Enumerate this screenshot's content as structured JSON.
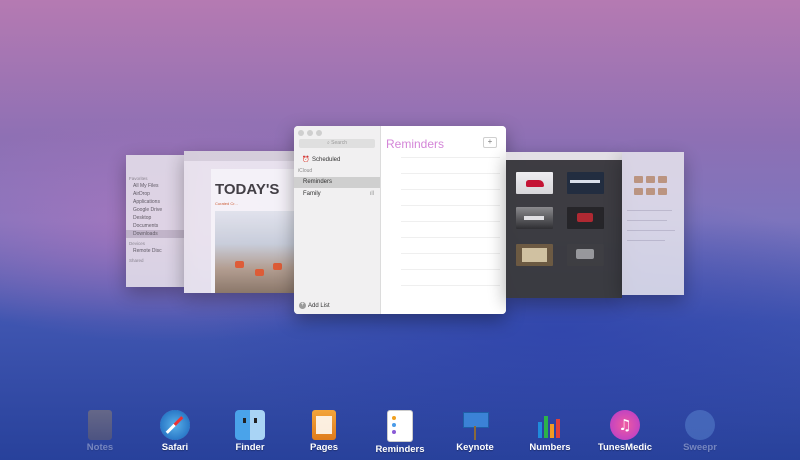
{
  "finder": {
    "favorites_header": "Favorites",
    "items": [
      "All My Files",
      "AirDrop",
      "Applications",
      "Google Drive",
      "Desktop",
      "Documents",
      "Downloads"
    ],
    "devices_header": "Devices",
    "devices": [
      "Remote Disc"
    ],
    "shared_header": "Shared"
  },
  "safari": {
    "headline": "TODAY'S",
    "subhead": "Curated Cr..."
  },
  "reminders": {
    "search_placeholder": "Search",
    "scheduled": "Scheduled",
    "icloud_header": "iCloud",
    "lists": [
      "Reminders",
      "Family"
    ],
    "title": "Reminders",
    "add_label": "+",
    "add_list": "Add List",
    "accent": "#d486d8"
  },
  "keynote": {
    "themes": [
      "",
      "",
      "",
      "",
      "",
      ""
    ]
  },
  "dock": {
    "apps": [
      {
        "label": "Notes",
        "icon": "notes-icon",
        "faded": true
      },
      {
        "label": "Safari",
        "icon": "safari-icon",
        "faded": false
      },
      {
        "label": "Finder",
        "icon": "finder-icon",
        "faded": false
      },
      {
        "label": "Pages",
        "icon": "pages-icon",
        "faded": false
      },
      {
        "label": "Reminders",
        "icon": "reminders-icon",
        "faded": false
      },
      {
        "label": "Keynote",
        "icon": "keynote-icon",
        "faded": false
      },
      {
        "label": "Numbers",
        "icon": "numbers-icon",
        "faded": false
      },
      {
        "label": "TunesMedic",
        "icon": "tunesmedic-icon",
        "faded": false
      },
      {
        "label": "Sweepr",
        "icon": "sweepr-icon",
        "faded": true
      }
    ]
  }
}
